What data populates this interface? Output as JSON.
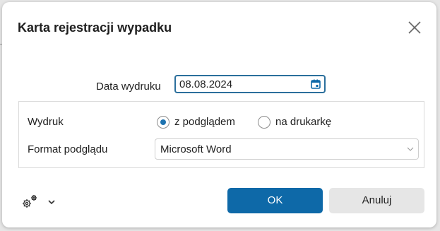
{
  "dialog": {
    "title": "Karta rejestracji wypadku"
  },
  "date": {
    "label": "Data wydruku",
    "value": "08.08.2024"
  },
  "print": {
    "label": "Wydruk",
    "options": [
      {
        "label": "z podglądem",
        "selected": true
      },
      {
        "label": "na drukarkę",
        "selected": false
      }
    ]
  },
  "format": {
    "label": "Format podglądu",
    "selected": "Microsoft Word"
  },
  "buttons": {
    "ok": "OK",
    "cancel": "Anuluj"
  },
  "icons": {
    "close": "close-icon",
    "calendar": "calendar-icon",
    "settings": "gears-icon",
    "dropdown": "chevron-down-icon"
  },
  "colors": {
    "accent": "#0e69a8",
    "input_border": "#2b6f9c",
    "radio_selected": "#1e73b0"
  }
}
